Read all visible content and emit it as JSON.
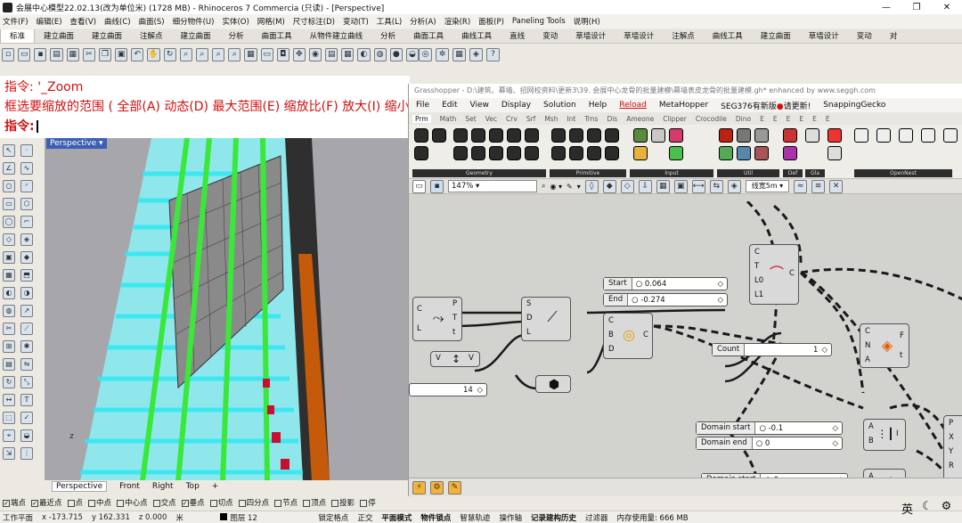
{
  "window": {
    "title": "会展中心模型22.02.13(改为单位米) (1728 MB) - Rhinoceros 7 Commercia (只读) - [Perspective]",
    "controls": [
      "—",
      "❐",
      "✕"
    ]
  },
  "menu": [
    "文件(F)",
    "编辑(E)",
    "查看(V)",
    "曲线(C)",
    "曲面(S)",
    "细分物件(U)",
    "实体(O)",
    "网格(M)",
    "尺寸标注(D)",
    "变动(T)",
    "工具(L)",
    "分析(A)",
    "渲染(R)",
    "面板(P)",
    "Paneling Tools",
    "说明(H)"
  ],
  "tabs": [
    "标准",
    "建立曲面",
    "建立曲面",
    "注解点",
    "建立曲面",
    "分析",
    "曲面工具",
    "从物件建立曲线",
    "分析",
    "曲面工具",
    "曲线工具",
    "直线",
    "变动",
    "草墙设计",
    "草墙设计",
    "注解点",
    "曲线工具",
    "建立曲面",
    "草墙设计",
    "变动",
    "对"
  ],
  "command": {
    "line1": "指令: '_Zoom",
    "line2": "框选要缩放的范围 ( 全部(A)  动态(D)  最大范围(E)  缩放比(F)  放大(I)  缩小",
    "line3": "指令:"
  },
  "viewport": {
    "title": "Perspective",
    "tabs": [
      "Perspective",
      "Front",
      "Right",
      "Top",
      "+"
    ],
    "axis": "z"
  },
  "osnap": {
    "items": [
      {
        "label": "端点",
        "checked": true
      },
      {
        "label": "最近点",
        "checked": true
      },
      {
        "label": "点",
        "checked": false
      },
      {
        "label": "中点",
        "checked": false
      },
      {
        "label": "中心点",
        "checked": false
      },
      {
        "label": "交点",
        "checked": false
      },
      {
        "label": "垂点",
        "checked": true
      },
      {
        "label": "切点",
        "checked": false
      },
      {
        "label": "四分点",
        "checked": false
      },
      {
        "label": "节点",
        "checked": false
      },
      {
        "label": "顶点",
        "checked": false
      },
      {
        "label": "投影",
        "checked": false
      },
      {
        "label": "停",
        "checked": false
      }
    ]
  },
  "status": {
    "plane": "工作平面",
    "x": "x -173.715",
    "y": "y 162.331",
    "z": "z 0.000",
    "unit": "米",
    "layer": "图层 12",
    "toggles": [
      "锁定格点",
      "正交",
      "平面模式",
      "物件锁点",
      "智慧轨迹",
      "操作轴",
      "记录建构历史",
      "过滤器"
    ],
    "bold_toggles": [
      "平面模式",
      "物件锁点",
      "记录建构历史"
    ],
    "memory": "内存使用量: 666 MB"
  },
  "tray": {
    "ime": "英",
    "icons": [
      "moon-icon",
      "gear-icon"
    ]
  },
  "grasshopper": {
    "title": "Grasshopper - D:\\建筑、幕墙、招网校资料\\更新3\\39. 会展中心龙骨的批量建模\\幕墙表皮龙骨的批量建模.gh*  enhanced by www.seggh.com",
    "menu": [
      "File",
      "Edit",
      "View",
      "Display",
      "Solution",
      "Help",
      "Reload",
      "MetaHopper",
      "SEG376有新版",
      "请更新!",
      "SnappingGecko"
    ],
    "tabs": [
      "Prm",
      "Math",
      "Set",
      "Vec",
      "Crv",
      "Srf",
      "Msh",
      "Int",
      "Trns",
      "Dis",
      "Ameone",
      "Clipper",
      "Crocodile",
      "Dino",
      "E",
      "E",
      "E",
      "E",
      "E",
      "E"
    ],
    "sections": [
      "Geometry",
      "Primitive",
      "Input",
      "Util",
      "Def",
      "Gla",
      "OpenNest"
    ],
    "zoom": "147%",
    "preview": "线宽5m",
    "sliders": {
      "start": {
        "label": "Start",
        "value": "0.064"
      },
      "end": {
        "label": "End",
        "value": "-0.274"
      },
      "count": {
        "label": "Count",
        "value": "1"
      },
      "n14": {
        "label": "",
        "value": "14"
      },
      "domain_start_1": {
        "label": "Domain start",
        "value": "-0.1"
      },
      "domain_end_1": {
        "label": "Domain end",
        "value": "0"
      },
      "domain_start_2": {
        "label": "Domain start",
        "value": "0"
      }
    },
    "nodes": {
      "curve_param": {
        "inputs": [
          "C",
          "L"
        ],
        "outputs": [
          "P",
          "T",
          "t"
        ]
      },
      "line_sdl": {
        "inputs": [
          "S",
          "D",
          "L"
        ],
        "outputs": []
      },
      "arc": {
        "inputs": [
          "C",
          "T",
          "L0",
          "L1"
        ],
        "outputs": [
          "C"
        ]
      },
      "cbd": {
        "inputs": [
          "C",
          "B",
          "D"
        ],
        "outputs": [
          "C"
        ]
      },
      "divide": {
        "inputs": [
          "C",
          "N",
          "A"
        ],
        "outputs": [
          "F",
          "t"
        ]
      },
      "vec": {
        "inputs": [
          "V"
        ],
        "outputs": [
          "V"
        ]
      },
      "ab1": {
        "inputs": [
          "A",
          "B"
        ],
        "outputs": [
          "I"
        ]
      },
      "ab2": {
        "inputs": [
          "A",
          "B"
        ],
        "outputs": [
          "I"
        ]
      },
      "pxyr": {
        "inputs": [],
        "outputs": [
          "P",
          "X",
          "Y",
          "R"
        ]
      }
    }
  }
}
